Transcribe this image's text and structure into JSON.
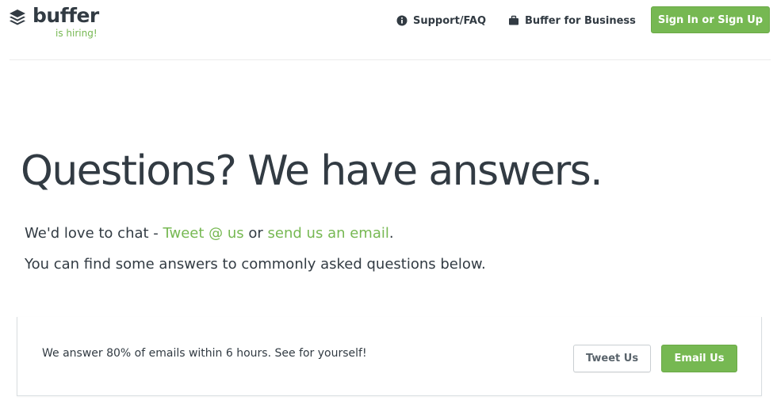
{
  "header": {
    "logo_text": "buffer",
    "hiring_text": "is hiring!",
    "nav": {
      "support_label": "Support/FAQ",
      "business_label": "Buffer for Business",
      "signin_label": "Sign In or Sign Up"
    }
  },
  "main": {
    "title": "Questions? We have answers.",
    "line1": {
      "prefix": "We'd love to chat - ",
      "tweet_link": "Tweet @ us",
      "middle": " or ",
      "email_link": "send us an email",
      "suffix": "."
    },
    "line2": "You can find some answers to commonly asked questions below."
  },
  "contact_box": {
    "text": "We answer 80% of emails within 6 hours. See for yourself!",
    "tweet_button": "Tweet Us",
    "email_button": "Email Us"
  },
  "colors": {
    "brand_green": "#76b852",
    "text_dark": "#323b43"
  },
  "icons": {
    "logo": "buffer-stack-logo-icon",
    "support": "info-circle-icon",
    "business": "briefcase-icon"
  }
}
